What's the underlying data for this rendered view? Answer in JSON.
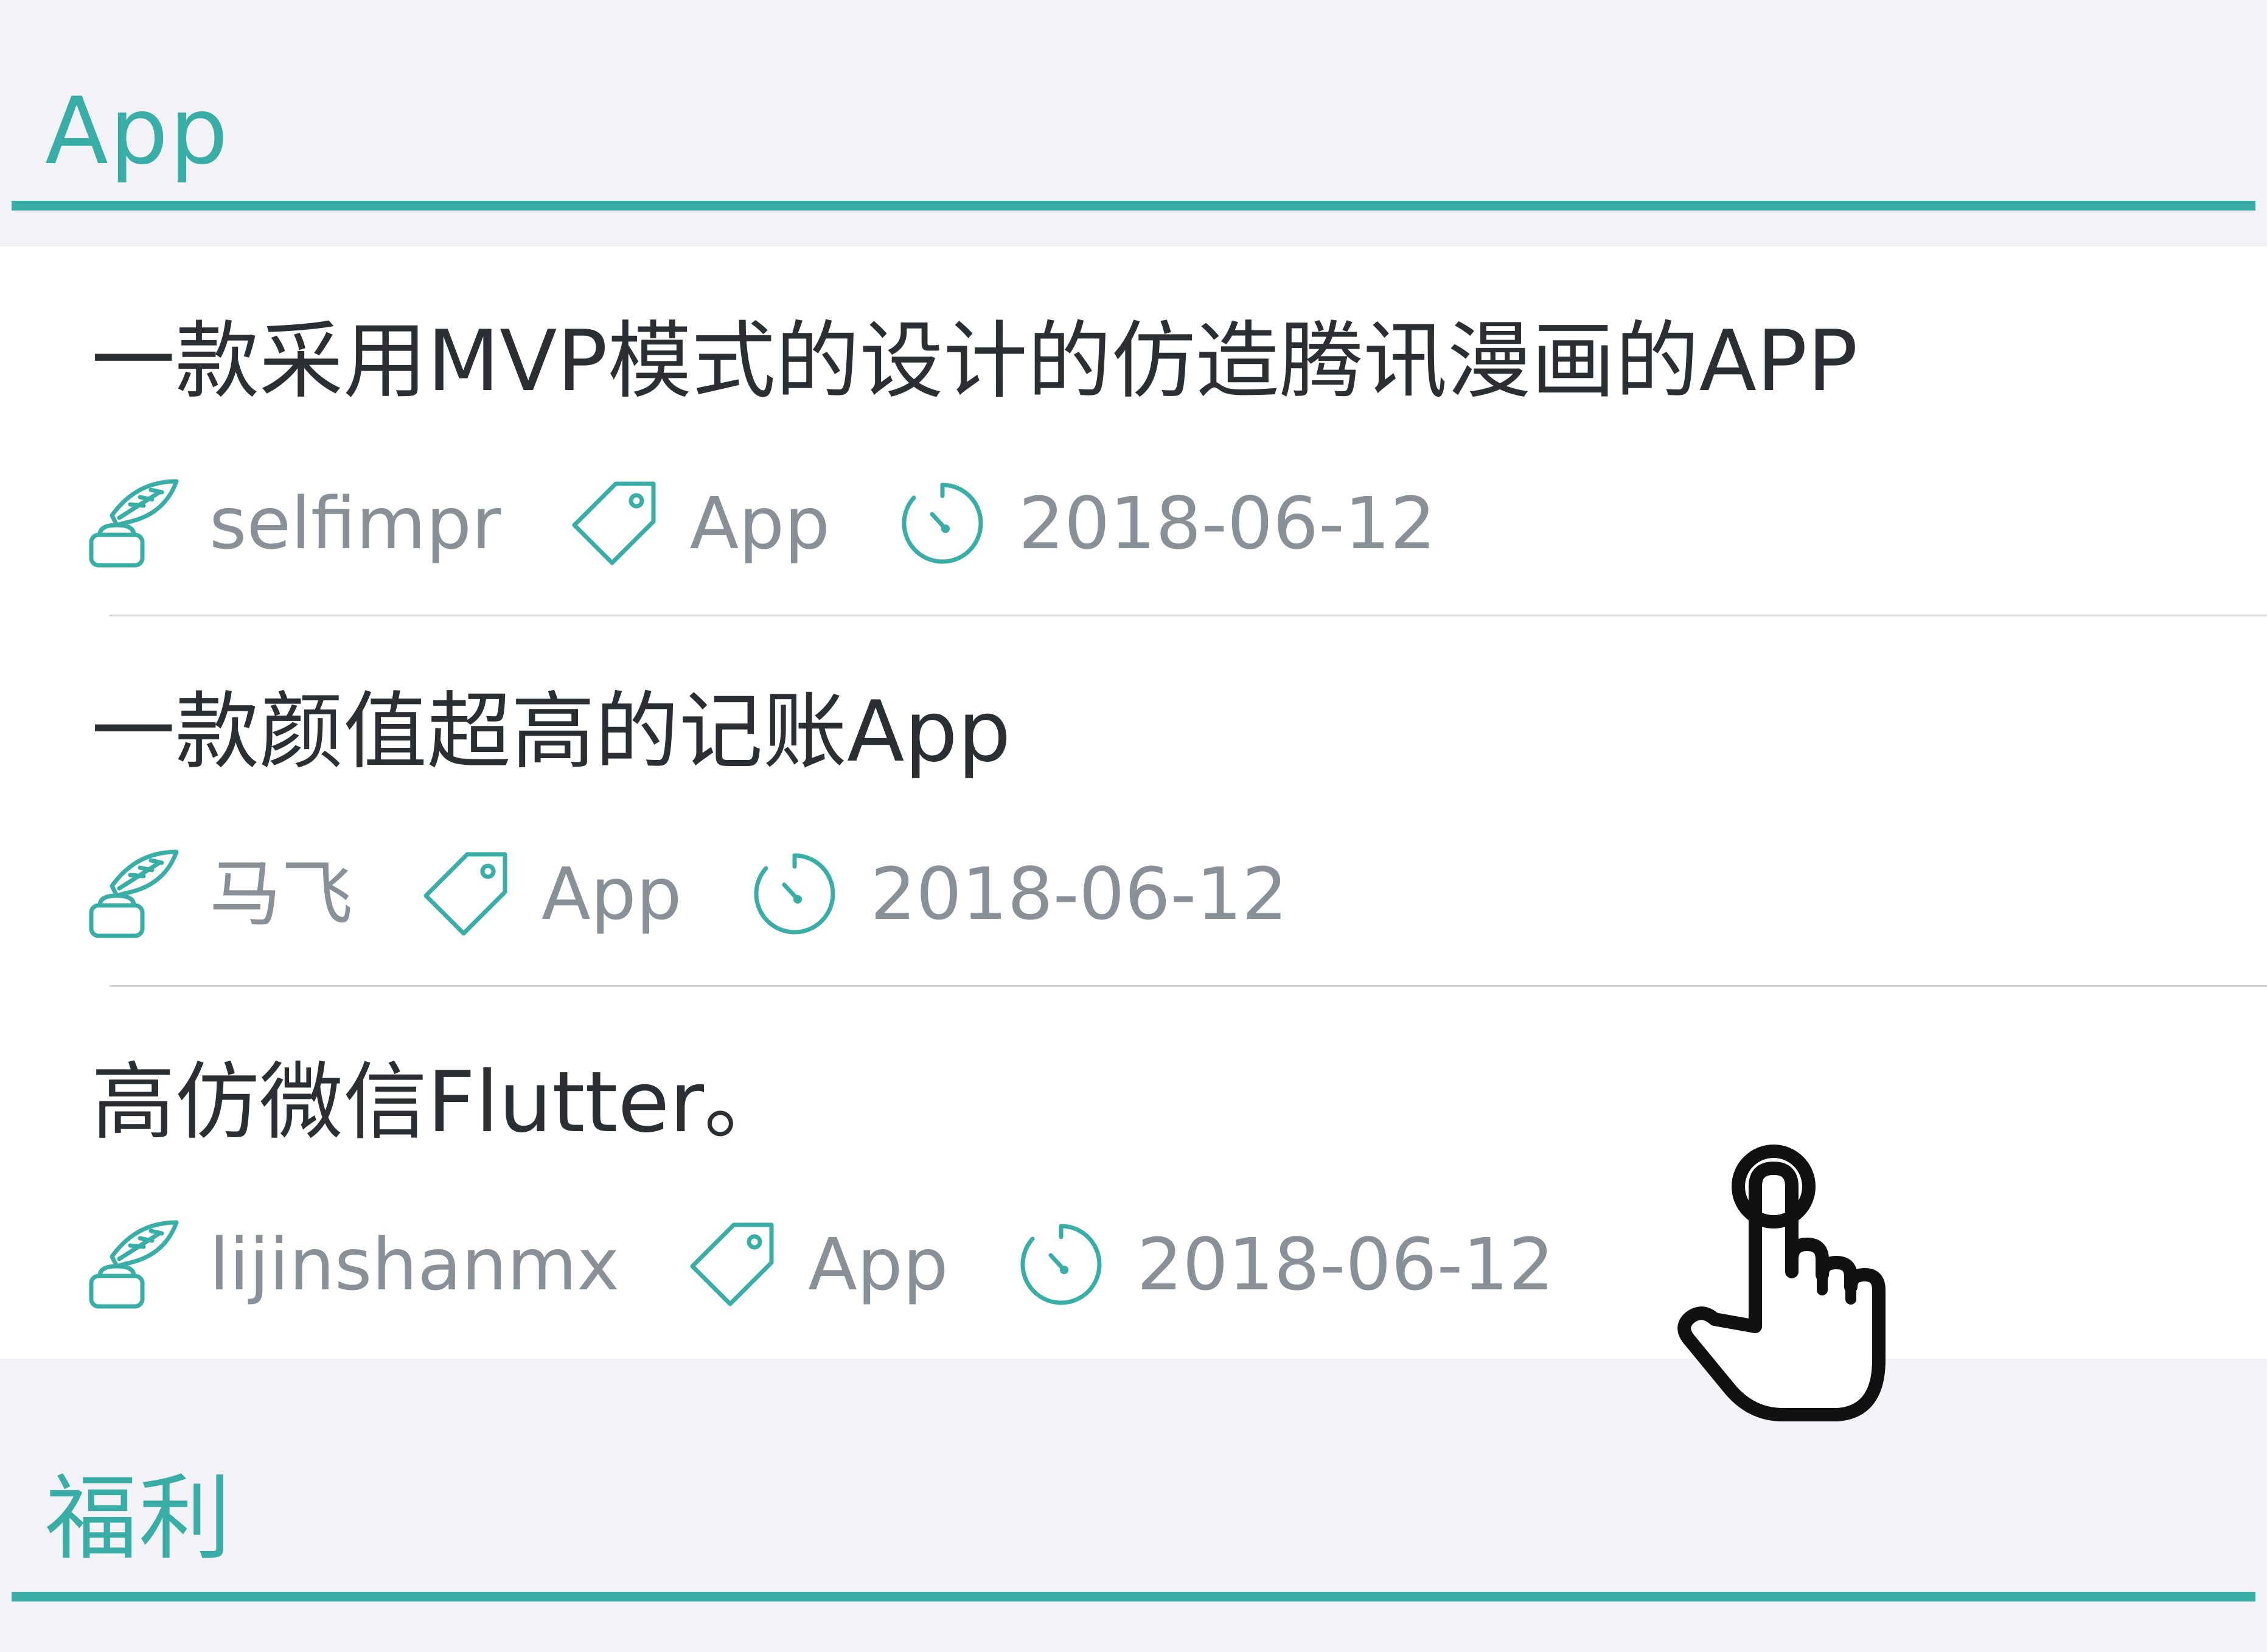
{
  "sections": [
    {
      "title": "App",
      "items": [
        {
          "title": "一款采用MVP模式的设计的仿造腾讯漫画的APP",
          "author": "selfimpr",
          "tag": "App",
          "date": "2018-06-12"
        },
        {
          "title": "一款颜值超高的记账App",
          "author": "马飞",
          "tag": "App",
          "date": "2018-06-12"
        },
        {
          "title": "高仿微信Flutter。",
          "author": "lijinshanmx",
          "tag": "App",
          "date": "2018-06-12"
        }
      ]
    },
    {
      "title": "福利",
      "items": []
    }
  ],
  "icons": {
    "author": "quill-ink-icon",
    "tag": "tag-icon",
    "date": "stopwatch-icon",
    "pointer": "hand-pointer-icon"
  },
  "colors": {
    "accent": "#38aea6",
    "title_text": "#2b2f33",
    "meta_text": "#8a9098",
    "background": "#f3f2f7",
    "card": "#ffffff"
  }
}
